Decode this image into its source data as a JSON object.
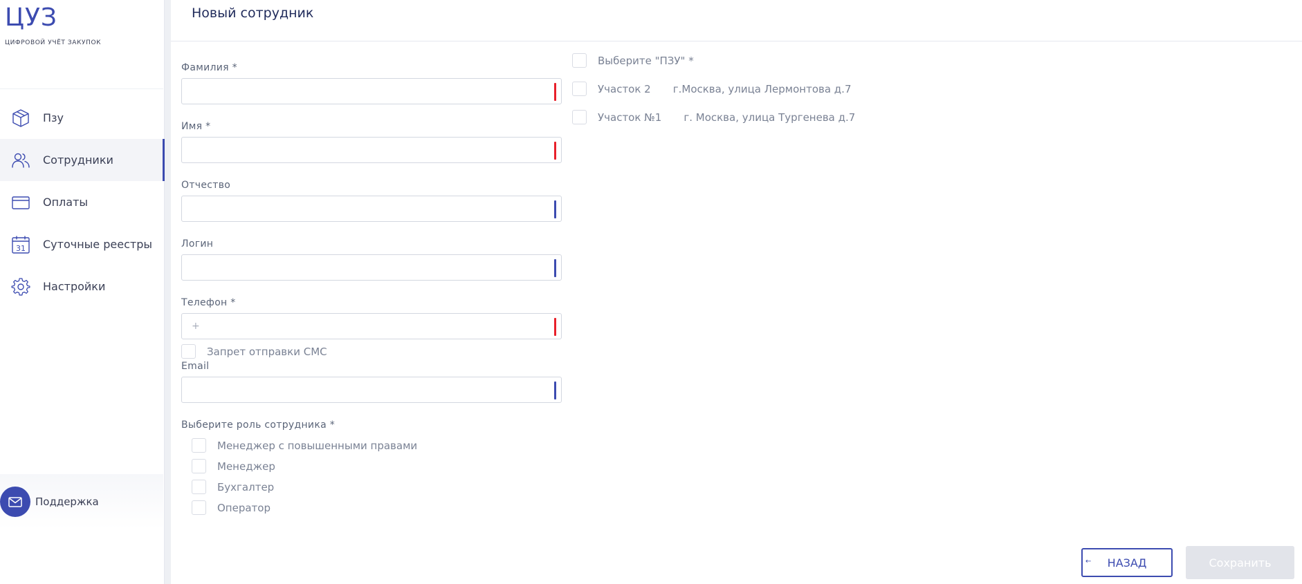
{
  "app": {
    "logo": "ЦУЗ",
    "logo_subtitle": "ЦИФРОВОЙ УЧЁТ ЗАКУПОК"
  },
  "sidebar": {
    "items": [
      {
        "label": "Пзу",
        "icon": "box-icon",
        "active": false
      },
      {
        "label": "Сотрудники",
        "icon": "users-icon",
        "active": true
      },
      {
        "label": "Оплаты",
        "icon": "card-icon",
        "active": false
      },
      {
        "label": "Суточные реестры",
        "icon": "calendar-icon",
        "active": false
      },
      {
        "label": "Настройки",
        "icon": "gear-icon",
        "active": false
      }
    ],
    "support_label": "Поддержка"
  },
  "header": {
    "title": "Новый сотрудник"
  },
  "form": {
    "lastname": {
      "label": "Фамилия *",
      "value": "",
      "placeholder": ""
    },
    "firstname": {
      "label": "Имя *",
      "value": "",
      "placeholder": ""
    },
    "patronymic": {
      "label": "Отчество",
      "value": "",
      "placeholder": ""
    },
    "login": {
      "label": "Логин",
      "value": "",
      "placeholder": ""
    },
    "phone": {
      "label": "Телефон *",
      "value": "",
      "placeholder": "+"
    },
    "sms_block": {
      "label": "Запрет отправки СМС",
      "checked": false
    },
    "email": {
      "label": "Email",
      "value": "",
      "placeholder": ""
    },
    "role_label": "Выберите роль сотрудника *",
    "roles": [
      {
        "label": "Менеджер с повышенными правами",
        "checked": false
      },
      {
        "label": "Менеджер",
        "checked": false
      },
      {
        "label": "Бухгалтер",
        "checked": false
      },
      {
        "label": "Оператор",
        "checked": false
      }
    ]
  },
  "pzu": {
    "select_label": "Выберите \"ПЗУ\" *",
    "items": [
      {
        "name": "Участок 2",
        "address": "г.Москва, улица Лермонтова д.7",
        "checked": false
      },
      {
        "name": "Участок №1",
        "address": "г. Москва, улица Тургенева д.7",
        "checked": false
      }
    ]
  },
  "actions": {
    "back_label": "НАЗАД",
    "save_label": "Сохранить"
  },
  "colors": {
    "accent": "#3c4bb0",
    "required_marker": "#e8202a",
    "disabled_button": "#e2e4ea"
  }
}
